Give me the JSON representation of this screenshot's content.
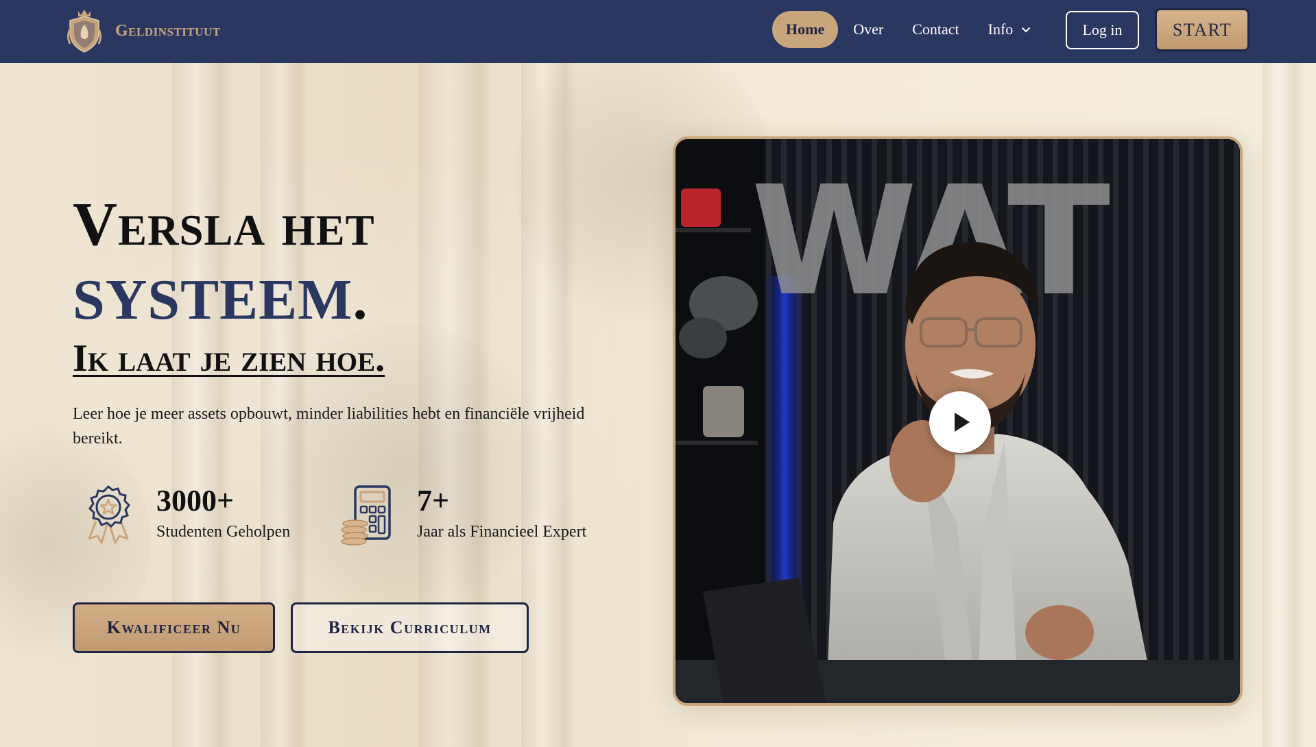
{
  "brand": {
    "name": "Geldinstituut",
    "logo_icon": "crest-icon"
  },
  "nav": {
    "items": [
      {
        "label": "Home",
        "active": true
      },
      {
        "label": "Over",
        "active": false
      },
      {
        "label": "Contact",
        "active": false
      },
      {
        "label": "Info",
        "active": false,
        "has_dropdown": true
      }
    ],
    "login_label": "Log in",
    "start_label": "START"
  },
  "hero": {
    "headline_line1": "Versla het",
    "headline_line2": "SYSTEEM",
    "headline_line2_punct": ".",
    "headline_line3": "Ik laat je zien hoe.",
    "lead": "Leer hoe je meer assets opbouwt, minder liabilities hebt en financiële vrijheid bereikt.",
    "stats": [
      {
        "value": "3000+",
        "label": "Studenten Geholpen",
        "icon": "award-badge-icon"
      },
      {
        "value": "7+",
        "label": "Jaar als Financieel Expert",
        "icon": "calculator-coins-icon"
      }
    ],
    "primary_button": "Kwalificeer Nu",
    "secondary_button": "Bekijk Curriculum"
  },
  "video": {
    "background_text": "WAT",
    "play_icon": "play-icon"
  },
  "colors": {
    "navy": "#2a3760",
    "gold": "#c9a57e",
    "cream": "#f1e8d8"
  }
}
